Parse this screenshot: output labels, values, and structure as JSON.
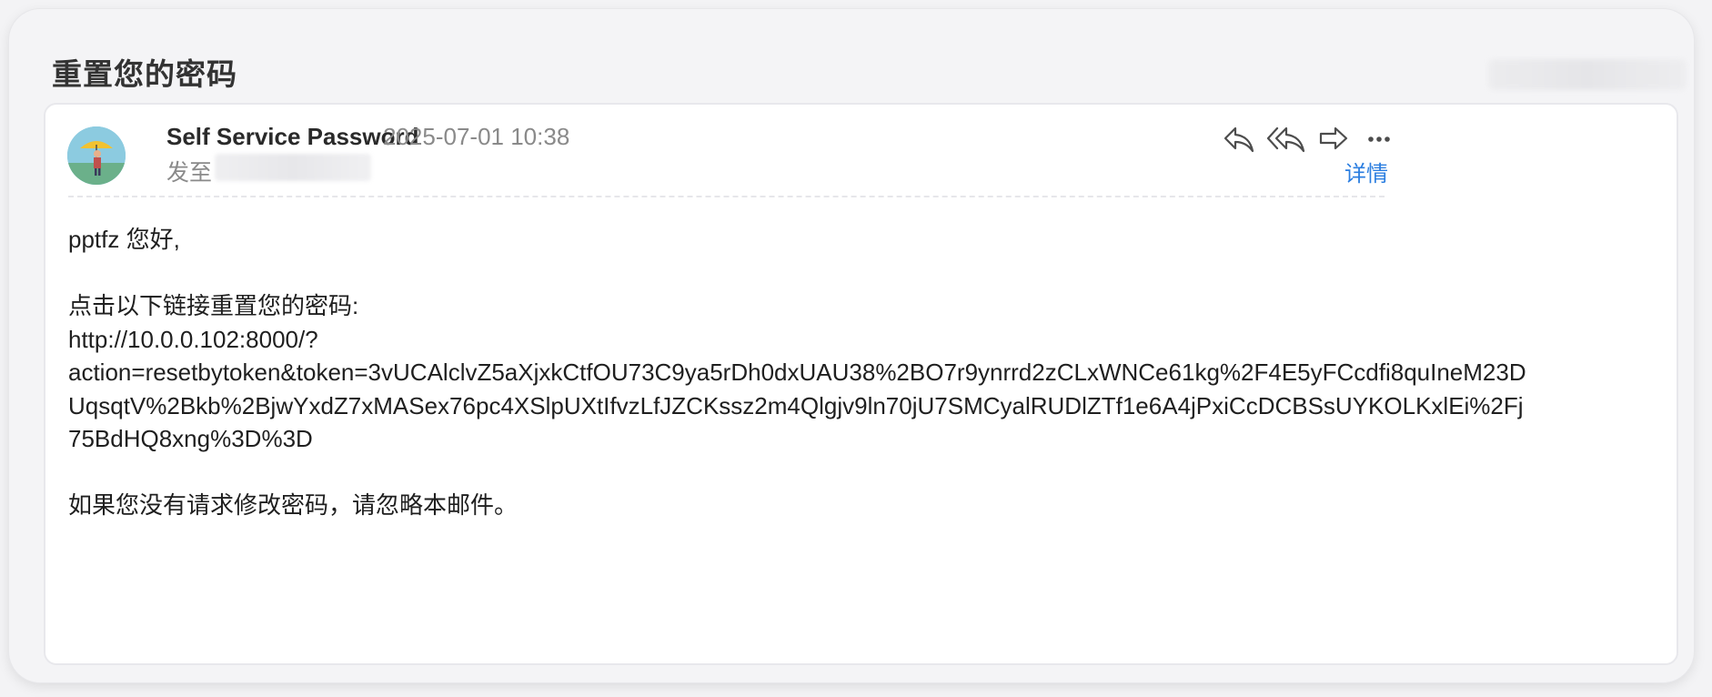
{
  "email": {
    "subject": "重置您的密码",
    "sender": "Self Service Password",
    "datetime": "2025-07-01 10:38",
    "to_label": "发至",
    "details_link": "详情"
  },
  "actions": {
    "reply": "reply-icon",
    "reply_all": "reply-all-icon",
    "forward": "forward-icon",
    "more": "more-icon"
  },
  "body": {
    "greeting": "pptfz 您好,",
    "instruction": "点击以下链接重置您的密码:",
    "link_lines": [
      "http://10.0.0.102:8000/?",
      "action=resetbytoken&token=3vUCAlclvZ5aXjxkCtfOU73C9ya5rDh0dxUAU38%2BO7r9ynrrd2zCLxWNCe61kg%2F4E5yFCcdfi8quIneM23D",
      "UqsqtV%2Bkb%2BjwYxdZ7xMASex76pc4XSlpUXtIfvzLfJZCKssz2m4Qlgjv9ln70jU7SMCyalRUDlZTf1e6A4jPxiCcDCBSsUYKOLKxlEi%2Fj",
      "75BdHQ8xng%3D%3D"
    ],
    "footer": "如果您没有请求修改密码，请忽略本邮件。"
  },
  "colors": {
    "accent": "#2b7ee0",
    "muted": "#8a8a8a"
  }
}
